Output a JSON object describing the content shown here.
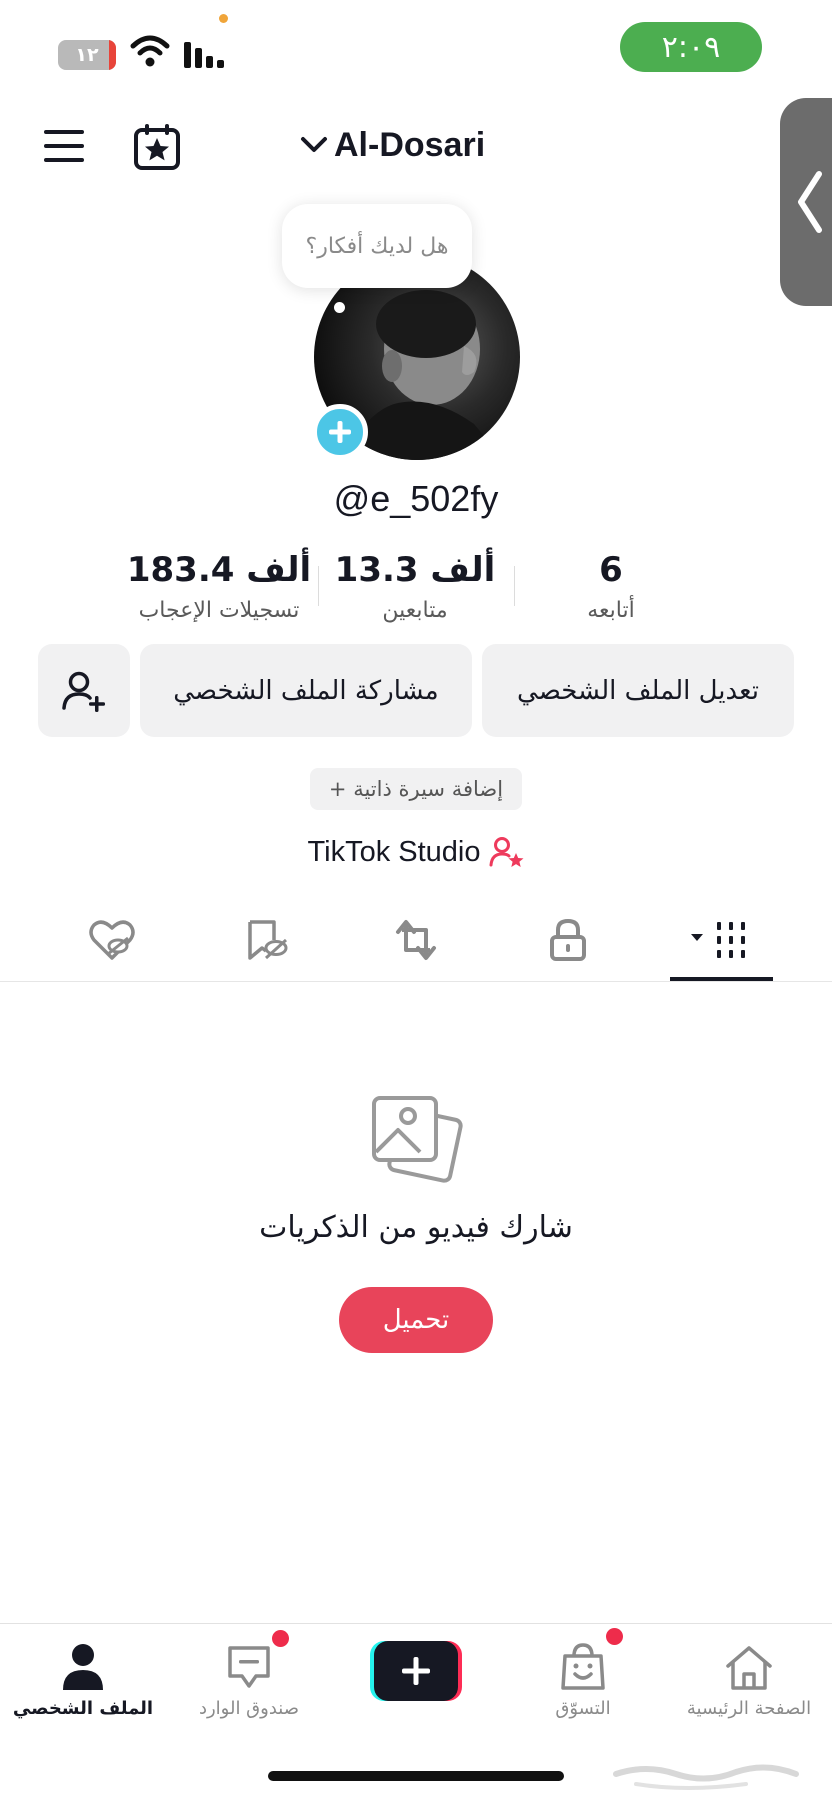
{
  "status_bar": {
    "time": "٢:٠٩",
    "battery": "١٢",
    "battery_level_percent": 12
  },
  "header": {
    "account_name": "Al-Dosari"
  },
  "profile": {
    "idea_prompt": "هل لديك أفكار؟",
    "handle": "@e_502fy",
    "stats": [
      {
        "value": "183.4 ألف",
        "label": "تسجيلات الإعجاب"
      },
      {
        "value": "13.3 ألف",
        "label": "متابعين"
      },
      {
        "value": "6",
        "label": "أتابعه"
      }
    ],
    "buttons": {
      "edit_profile": "تعديل الملف الشخصي",
      "share_profile": "مشاركة الملف الشخصي"
    },
    "add_bio": "+ إضافة سيرة ذاتية",
    "studio": "TikTok Studio"
  },
  "tabs": {
    "active": "videos",
    "items": [
      "liked",
      "favorites",
      "reposts",
      "private",
      "videos"
    ]
  },
  "empty_state": {
    "message": "شارك فيديو من الذكريات",
    "upload_label": "تحميل"
  },
  "bottom_nav": {
    "profile": "الملف الشخصي",
    "inbox": "صندوق الوارد",
    "shop": "التسوّق",
    "home": "الصفحة الرئيسية"
  },
  "colors": {
    "accent_red": "#e8445a",
    "status_green": "#4cae50",
    "plus_cyan": "#4cc6e6"
  }
}
